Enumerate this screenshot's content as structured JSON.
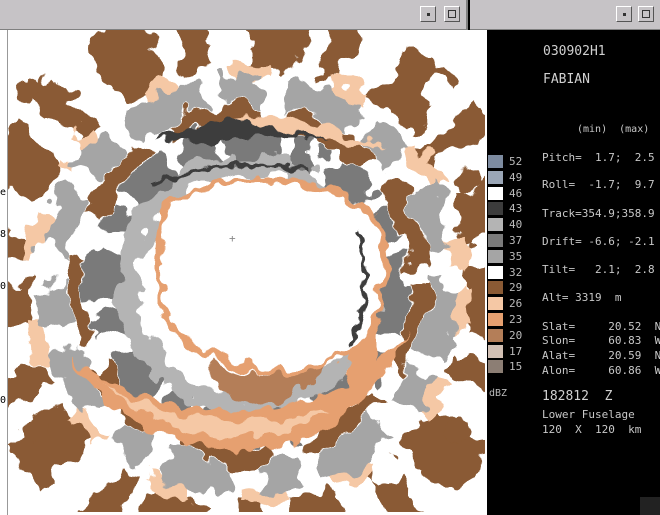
{
  "left_window": {
    "title": ""
  },
  "right_window": {
    "title": ""
  },
  "edge_marks": [
    "e",
    "8",
    "0",
    "0"
  ],
  "legend": {
    "levels": [
      {
        "value": "52",
        "color": "#7d8ba0"
      },
      {
        "value": "49",
        "color": "#9aa6b6"
      },
      {
        "value": "46",
        "color": "#ffffff"
      },
      {
        "value": "43",
        "color": "#3c3c3c"
      },
      {
        "value": "40",
        "color": "#b4b4b4"
      },
      {
        "value": "37",
        "color": "#7a7a7a"
      },
      {
        "value": "35",
        "color": "#a5a5a5"
      },
      {
        "value": "32",
        "color": "#ffffff"
      },
      {
        "value": "29",
        "color": "#8a5a34"
      },
      {
        "value": "26",
        "color": "#f5c8a5"
      },
      {
        "value": "23",
        "color": "#e6a070"
      },
      {
        "value": "20",
        "color": "#b47e58"
      },
      {
        "value": "17",
        "color": "#d2c0b4"
      },
      {
        "value": "15",
        "color": "#8c7e74"
      }
    ],
    "unit": "dBZ"
  },
  "info": {
    "flight_id": "030902H1",
    "storm_name": "FABIAN",
    "minmax_header": "(min)  (max)",
    "pitch": "Pitch=  1.7;  2.5",
    "roll": "Roll=  -1.7;  9.7",
    "track": "Track=354.9;358.9",
    "drift": "Drift= -6.6; -2.1",
    "tilt": "Tilt=   2.1;  2.8",
    "alt": "Alt= 3319  m",
    "slat": "Slat=     20.52  N",
    "slon": "Slon=     60.83  W",
    "alat": "Alat=     20.59  N",
    "alon": "Alon=     60.86  W",
    "time": "182812  Z",
    "antenna": "Lower Fuselage",
    "range": "120  X  120  km"
  }
}
